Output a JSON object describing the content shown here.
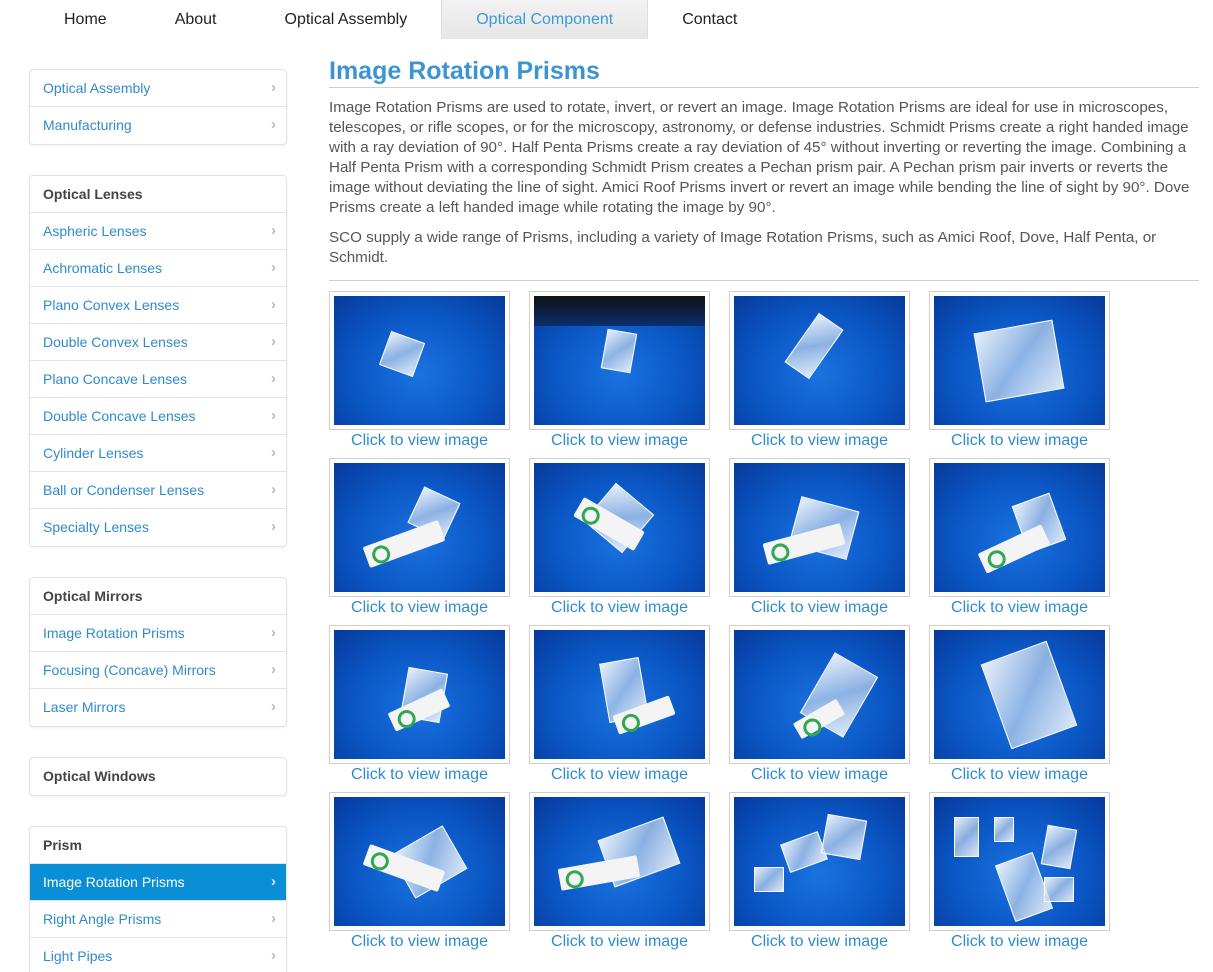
{
  "nav": {
    "items": [
      "Home",
      "About",
      "Optical Assembly",
      "Optical Component",
      "Contact"
    ],
    "active": "Optical Component"
  },
  "sidebar": {
    "groups": [
      {
        "header": null,
        "items": [
          "Optical Assembly",
          "Manufacturing"
        ]
      },
      {
        "header": "Optical Lenses",
        "items": [
          "Aspheric Lenses",
          "Achromatic Lenses",
          "Plano Convex Lenses",
          "Double Convex Lenses",
          "Plano Concave Lenses",
          "Double Concave Lenses",
          "Cylinder Lenses",
          "Ball or Condenser Lenses",
          "Specialty Lenses"
        ]
      },
      {
        "header": "Optical Mirrors",
        "items": [
          "Image Rotation Prisms",
          "Focusing (Concave) Mirrors",
          "Laser Mirrors"
        ]
      },
      {
        "header": "Optical Windows",
        "items": []
      },
      {
        "header": "Prism",
        "items": [
          "Image Rotation Prisms",
          "Right Angle Prisms",
          "Light Pipes"
        ]
      }
    ],
    "active": "Image Rotation Prisms",
    "chevron_icon": "chevron-right-icon"
  },
  "main": {
    "title": "Image Rotation Prisms",
    "paragraphs": [
      "Image Rotation Prisms are used to rotate, invert, or revert an image. Image Rotation Prisms are ideal for use in microscopes, telescopes, or rifle scopes, or for the microscopy, astronomy, or defense industries. Schmidt Prisms create a right handed image with a ray deviation of 90°. Half Penta Prisms create a ray deviation of 45° without inverting or reverting the image. Combining a Half Penta Prism with a corresponding Schmidt Prism creates a Pechan prism pair. A Pechan prism pair inverts or reverts the image without deviating the line of sight. Amici Roof Prisms invert or revert an image while bending the line of sight by 90°. Dove Prisms create a left handed image while rotating the image by 90°.",
      "SCO supply a wide range of Prisms, including a variety of Image Rotation Prisms, such as Amici Roof, Dove, Half Penta, or Schmidt."
    ],
    "gallery_caption": "Click to view image",
    "gallery_count": 16
  },
  "colors": {
    "accent": "#3d94d2",
    "link": "#2e8bcb",
    "active_bg": "#0a8fd6",
    "thumb_bg": "#0a56c4"
  }
}
